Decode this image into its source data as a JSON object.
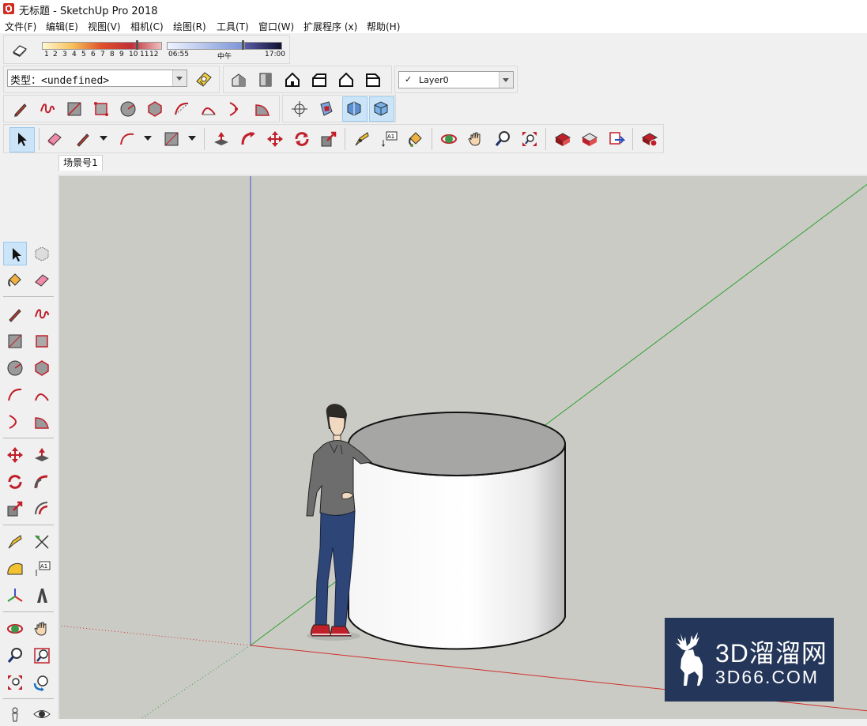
{
  "window": {
    "title": "无标题 - SketchUp Pro 2018"
  },
  "menu": [
    "文件(F)",
    "编辑(E)",
    "视图(V)",
    "相机(C)",
    "绘图(R)",
    "工具(T)",
    "窗口(W)",
    "扩展程序 (x)",
    "帮助(H)"
  ],
  "shadow_slider": {
    "months": [
      "1",
      "2",
      "3",
      "4",
      "5",
      "6",
      "7",
      "8",
      "9",
      "10",
      "11",
      "12"
    ],
    "time_start": "06:55",
    "time_mid": "中午",
    "time_end": "17:00"
  },
  "type_selector": {
    "label": "类型：",
    "value": "<undefined>"
  },
  "layer_selector": {
    "check": "✓",
    "value": "Layer0"
  },
  "scene_tab": "场景号1",
  "watermark": {
    "title": "3D溜溜网",
    "subtitle": "3D66.COM"
  },
  "colors": {
    "axis_red": "#d0302a",
    "axis_green": "#2fa02f",
    "axis_blue": "#4050c8",
    "active_tool": "#cce4f7",
    "watermark_bg": "#243659"
  }
}
